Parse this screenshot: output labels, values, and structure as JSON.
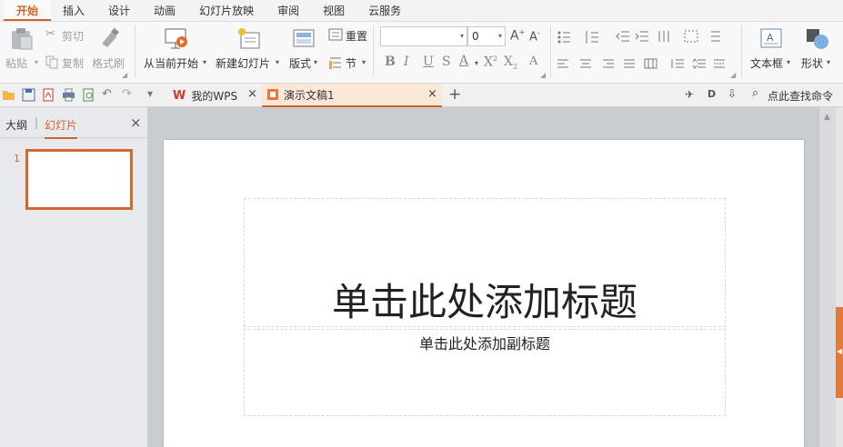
{
  "menu": {
    "tabs": [
      "开始",
      "插入",
      "设计",
      "动画",
      "幻灯片放映",
      "审阅",
      "视图",
      "云服务"
    ]
  },
  "ribbon": {
    "paste": "粘贴",
    "cut": "剪切",
    "copy": "复制",
    "format_painter": "格式刷",
    "from_current": "从当前开始",
    "new_slide": "新建幻灯片",
    "layout": "版式",
    "reset": "重置",
    "section": "节",
    "font_size": "0",
    "textbox": "文本框",
    "shape": "形状"
  },
  "quickbar": {
    "tab_wps": "我的WPS",
    "tab_doc": "演示文稿1",
    "search": "点此查找命令"
  },
  "left_panel": {
    "tab_outline": "大纲",
    "tab_slides": "幻灯片",
    "slide_number": "1"
  },
  "slide": {
    "title_placeholder": "单击此处添加标题",
    "subtitle_placeholder": "单击此处添加副标题"
  },
  "colors": {
    "accent": "#d0652b"
  }
}
